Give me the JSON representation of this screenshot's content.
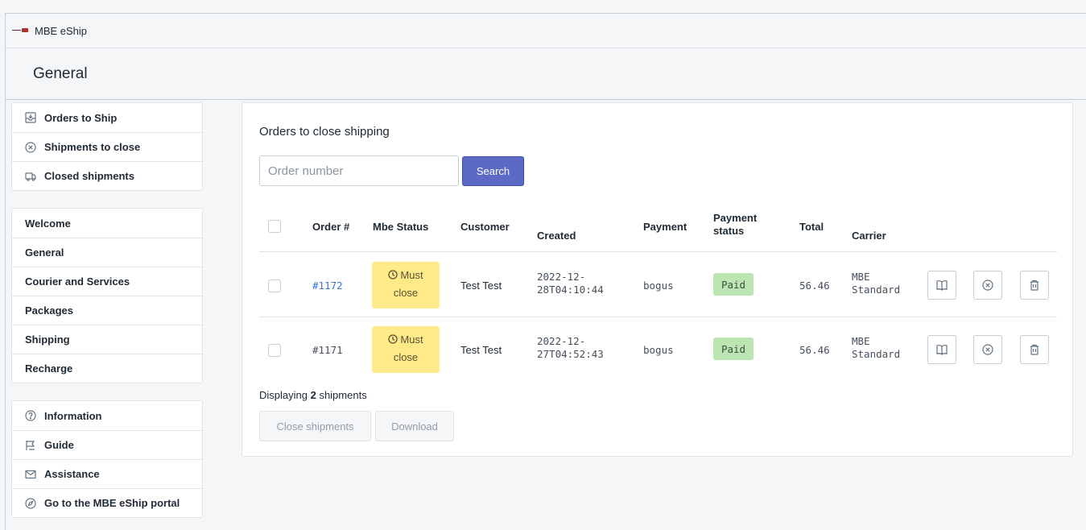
{
  "app": {
    "name": "MBE eShip"
  },
  "page": {
    "title": "General"
  },
  "sidebar": {
    "group1": [
      {
        "label": "Orders to Ship",
        "icon": "inbox-download-icon"
      },
      {
        "label": "Shipments to close",
        "icon": "circle-x-icon"
      },
      {
        "label": "Closed shipments",
        "icon": "truck-icon"
      }
    ],
    "group2": [
      {
        "label": "Welcome"
      },
      {
        "label": "General"
      },
      {
        "label": "Courier and Services"
      },
      {
        "label": "Packages"
      },
      {
        "label": "Shipping"
      },
      {
        "label": "Recharge"
      }
    ],
    "group3": [
      {
        "label": "Information",
        "icon": "question-circle-icon"
      },
      {
        "label": "Guide",
        "icon": "guide-icon"
      },
      {
        "label": "Assistance",
        "icon": "envelope-icon"
      },
      {
        "label": "Go to the MBE eShip portal",
        "icon": "compass-icon"
      }
    ]
  },
  "main": {
    "title": "Orders to close shipping",
    "search": {
      "placeholder": "Order number",
      "value": "",
      "button": "Search"
    },
    "columns": {
      "order": "Order #",
      "mbe_status": "Mbe Status",
      "customer": "Customer",
      "created": "Created",
      "payment": "Payment",
      "payment_status_1": "Payment",
      "payment_status_2": "status",
      "total": "Total",
      "carrier": "Carrier"
    },
    "rows": [
      {
        "order": "#1172",
        "mbe_status_1": "Must",
        "mbe_status_2": "close",
        "customer": "Test Test",
        "created_1": "2022-12-",
        "created_2": "28T04:10:44",
        "payment": "bogus",
        "payment_status": "Paid",
        "total": "56.46",
        "carrier_1": "MBE",
        "carrier_2": "Standard"
      },
      {
        "order": "#1171",
        "mbe_status_1": "Must",
        "mbe_status_2": "close",
        "customer": "Test Test",
        "created_1": "2022-12-",
        "created_2": "27T04:52:43",
        "payment": "bogus",
        "payment_status": "Paid",
        "total": "56.46",
        "carrier_1": "MBE",
        "carrier_2": "Standard"
      }
    ],
    "footer": {
      "displaying_prefix": "Displaying ",
      "count": "2",
      "displaying_suffix": " shipments",
      "close_button": "Close shipments",
      "download_button": "Download"
    }
  },
  "colors": {
    "accent": "#5c6ac4",
    "link": "#3a72d8",
    "status_warning": "#ffea8a",
    "status_success": "#bbe5b3"
  }
}
